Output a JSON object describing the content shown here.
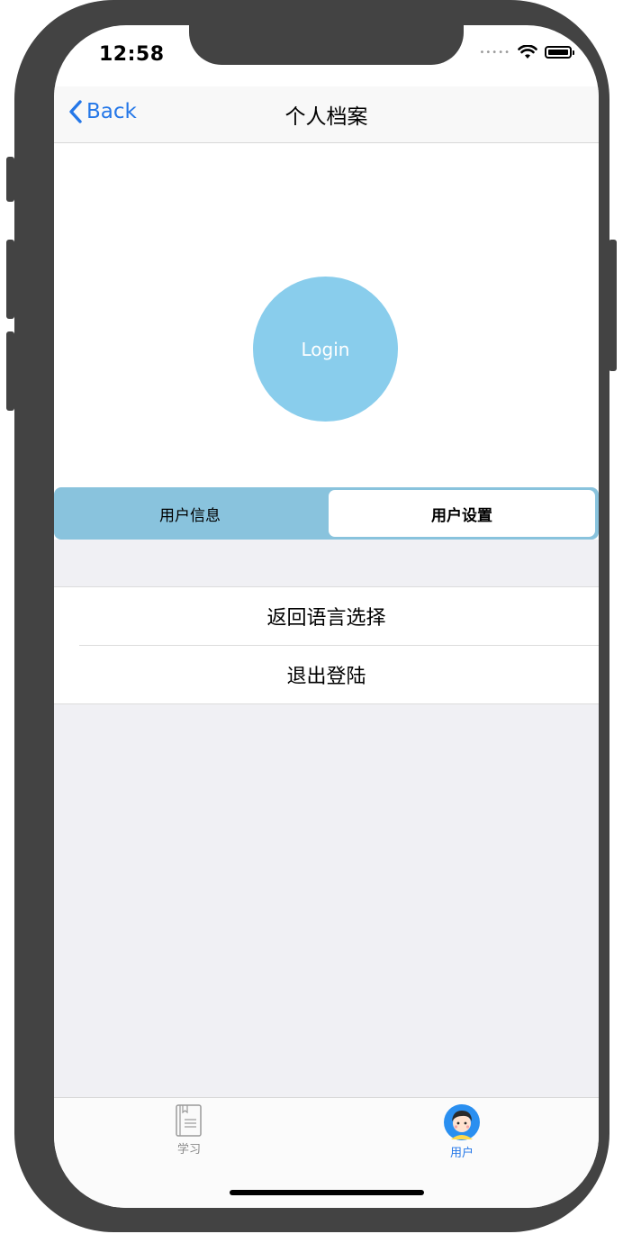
{
  "status_bar": {
    "time": "12:58"
  },
  "nav": {
    "back_label": "Back",
    "title": "个人档案"
  },
  "profile": {
    "login_label": "Login"
  },
  "segment": {
    "left_label": "用户信息",
    "right_label": "用户设置"
  },
  "settings_list": [
    {
      "label": "返回语言选择"
    },
    {
      "label": "退出登陆"
    }
  ],
  "tab_bar": {
    "tabs": [
      {
        "label": "学习",
        "icon": "book-icon",
        "selected": false
      },
      {
        "label": "用户",
        "icon": "user-avatar-icon",
        "selected": true
      }
    ]
  },
  "colors": {
    "accent": "#2477e8",
    "login_circle": "#89cdec",
    "segment_bg": "#89c3dd",
    "background_gray": "#f0f0f4",
    "phone_frame": "#434343"
  }
}
